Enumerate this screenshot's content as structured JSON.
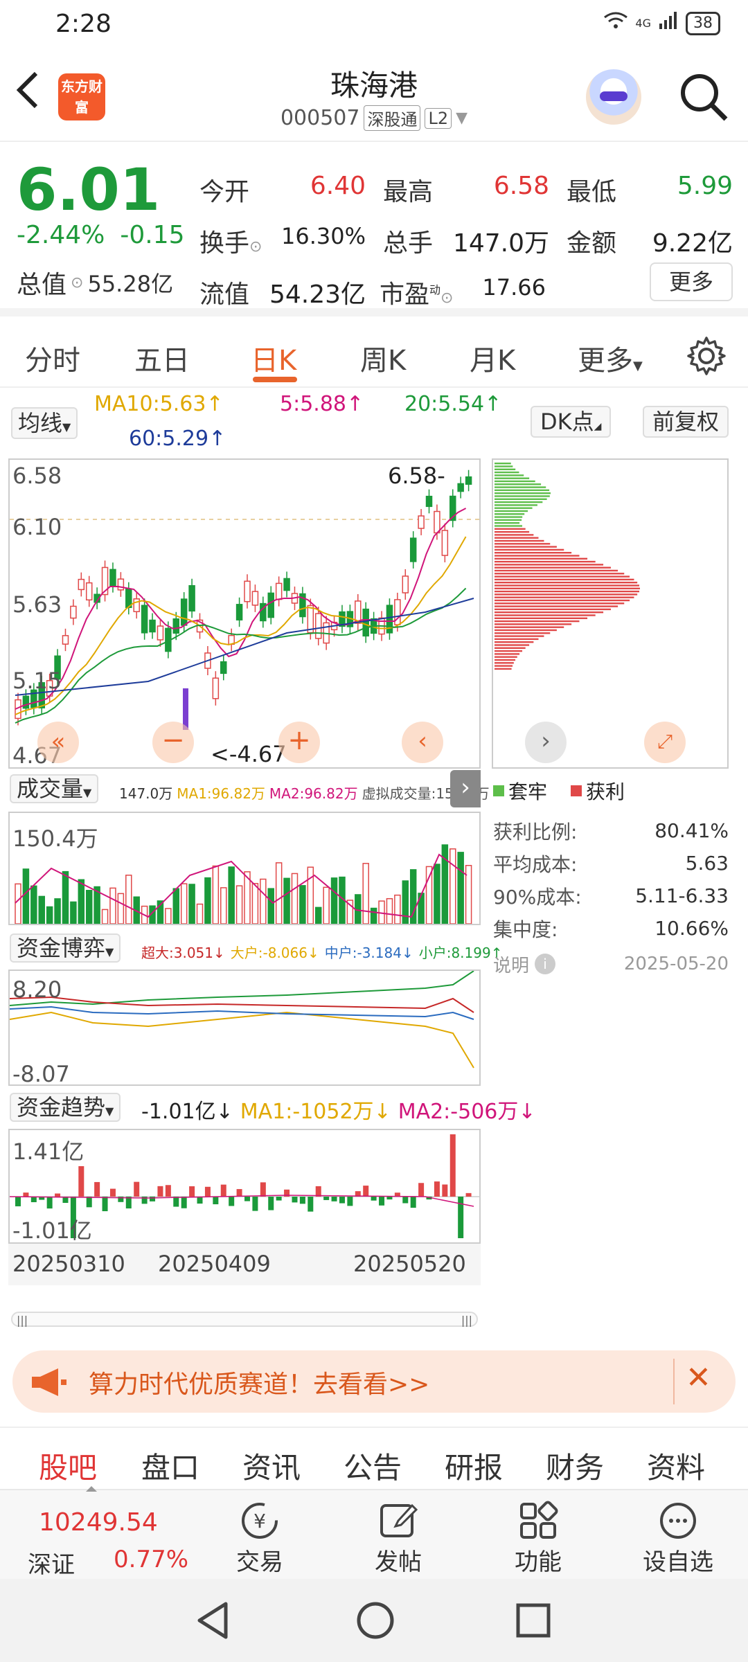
{
  "status": {
    "time": "2:28",
    "network": "4G",
    "battery": "38"
  },
  "header": {
    "logo": "东方财富",
    "stock_name": "珠海港",
    "stock_code": "000507",
    "badge1": "深股通",
    "badge2": "L2"
  },
  "quote": {
    "price": "6.01",
    "change_pct": "-2.44%",
    "change_abs": "-0.15",
    "total_value_label": "总值",
    "total_value": "55.28亿",
    "rows": [
      [
        {
          "label": "今开",
          "value": "6.40",
          "color": "red"
        },
        {
          "label": "最高",
          "value": "6.58",
          "color": "red"
        },
        {
          "label": "最低",
          "value": "5.99",
          "color": "green"
        }
      ],
      [
        {
          "label": "换手",
          "value": "16.30%",
          "color": "black"
        },
        {
          "label": "总手",
          "value": "147.0万",
          "color": "black"
        },
        {
          "label": "金额",
          "value": "9.22亿",
          "color": "black"
        }
      ],
      [
        {
          "label": "流值",
          "value": "54.23亿",
          "color": "black"
        },
        {
          "label": "市盈",
          "value": "17.66",
          "color": "black"
        }
      ]
    ],
    "pe_sup": "动",
    "more": "更多"
  },
  "tabs": [
    "分时",
    "五日",
    "日K",
    "周K",
    "月K",
    "更多"
  ],
  "active_tab": "日K",
  "ma_bar": {
    "button": "均线",
    "ma10": "MA10:5.63↑",
    "ma5": "5:5.88↑",
    "ma20": "20:5.54↑",
    "ma60": "60:5.29↑",
    "dk": "DK点",
    "adj": "前复权"
  },
  "kline": {
    "y_high": "6.58",
    "y_mid1": "6.10",
    "y_mid2": "5.63",
    "y_mid3": "5.15",
    "y_low": "4.67",
    "high_marker": "6.58-",
    "low_marker": "<-4.67"
  },
  "volume": {
    "button": "成交量",
    "values": "147.0万",
    "ma1": "MA1:96.82万",
    "ma2": "MA2:96.82万",
    "virtual": "虚拟成交量:150.4万",
    "y_top": "150.4万"
  },
  "capital": {
    "button": "资金博弈",
    "super": "超大:3.051↓",
    "large": "大户:-8.066↓",
    "mid": "中户:-3.184↓",
    "small": "小户:8.199↑",
    "y_top": "8.20",
    "y_bot": "-8.07"
  },
  "trend": {
    "button": "资金趋势",
    "value": "-1.01亿↓",
    "ma1": "MA1:-1052万↓",
    "ma2": "MA2:-506万↓",
    "y_top": "1.41亿",
    "y_bot": "-1.01亿"
  },
  "dates": [
    "20250310",
    "20250409",
    "20250520"
  ],
  "distribution": {
    "legend_trapped": "套牢",
    "legend_profit": "获利",
    "rows": [
      {
        "label": "获利比例:",
        "value": "80.41%"
      },
      {
        "label": "平均成本:",
        "value": "5.63"
      },
      {
        "label": "90%成本:",
        "value": "5.11-6.33"
      },
      {
        "label": "集中度:",
        "value": "10.66%"
      }
    ],
    "note": "说明",
    "date": "2025-05-20"
  },
  "banner": {
    "text": "算力时代优质赛道！去看看>>"
  },
  "bottom_tabs": [
    "股吧",
    "盘口",
    "资讯",
    "公告",
    "研报",
    "财务",
    "资料"
  ],
  "toolbar": {
    "index_value": "10249.54",
    "index_name": "深证",
    "index_change": "0.77%",
    "items": [
      "交易",
      "发帖",
      "功能",
      "设自选"
    ]
  }
}
